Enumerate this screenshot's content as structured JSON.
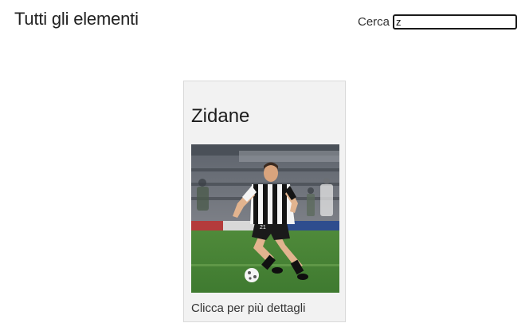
{
  "header": {
    "title": "Tutti gli elementi",
    "search_label": "Cerca",
    "search_value": "z"
  },
  "results": [
    {
      "name": "Zidane",
      "image": "footballer-photo",
      "cta": "Clicca per più dettagli"
    }
  ],
  "colors": {
    "card_background": "#f2f2f2",
    "card_border": "#d9d9d9",
    "text": "#222222"
  }
}
